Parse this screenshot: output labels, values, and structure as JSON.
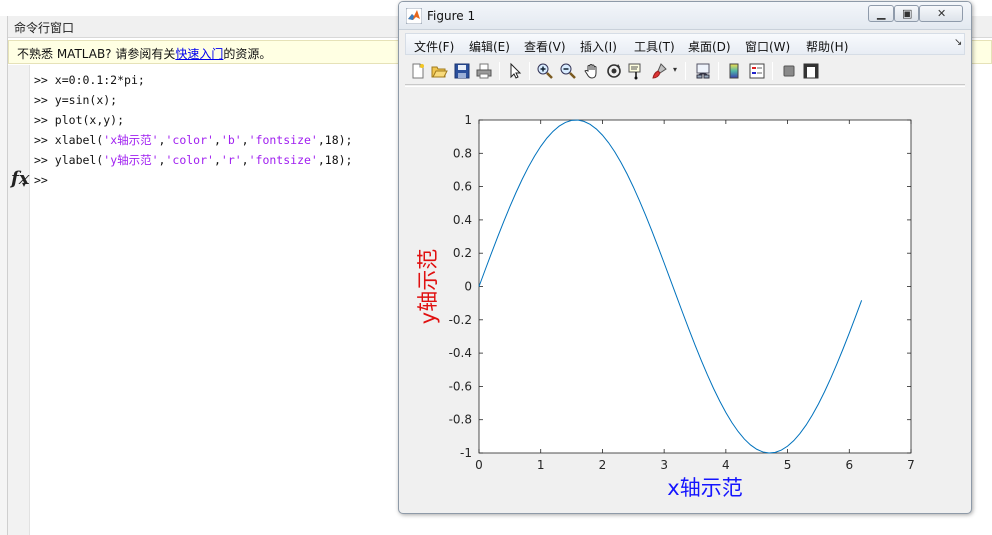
{
  "command_window": {
    "title": "命令行窗口",
    "notice_prefix": "不熟悉 MATLAB? 请参阅有关",
    "notice_link": "快速入门",
    "notice_suffix": "的资源。",
    "prompt": ">>",
    "fx_label": "fx",
    "lines": [
      {
        "code_a": "x=0:0.1:2*pi;",
        "str1": "",
        "code_b": "",
        "str2": "",
        "code_c": "",
        "str3": "",
        "code_d": ""
      },
      {
        "code_a": "y=sin(x);",
        "str1": "",
        "code_b": "",
        "str2": "",
        "code_c": "",
        "str3": "",
        "code_d": ""
      },
      {
        "code_a": "plot(x,y);",
        "str1": "",
        "code_b": "",
        "str2": "",
        "code_c": "",
        "str3": "",
        "code_d": ""
      },
      {
        "code_a": "xlabel(",
        "str1": "'x轴示范'",
        "code_b": ",",
        "str2": "'color'",
        "code_c": ",",
        "str3": "'b'",
        "code_d": ",'fontsize',18);"
      },
      {
        "code_a": "ylabel(",
        "str1": "'y轴示范'",
        "code_b": ",",
        "str2": "'color'",
        "code_c": ",",
        "str3": "'r'",
        "code_d": ",'fontsize',18);"
      },
      {
        "code_a": "",
        "str1": "",
        "code_b": "",
        "str2": "",
        "code_c": "",
        "str3": "",
        "code_d": ""
      }
    ]
  },
  "figure": {
    "title": "Figure 1",
    "menus": [
      "文件(F)",
      "编辑(E)",
      "查看(V)",
      "插入(I)",
      "工具(T)",
      "桌面(D)",
      "窗口(W)",
      "帮助(H)"
    ],
    "toolbar_icons": [
      "new-figure-icon",
      "open-file-icon",
      "save-icon",
      "print-icon",
      "edit-plot-arrow-icon",
      "zoom-in-icon",
      "zoom-out-icon",
      "pan-hand-icon",
      "rotate-3d-icon",
      "data-cursor-icon",
      "brush-icon",
      "brush-dropdown-icon",
      "link-plot-icon",
      "colorbar-icon",
      "legend-icon",
      "hide-plot-tools-icon",
      "show-plot-tools-icon"
    ]
  },
  "chart_data": {
    "type": "line",
    "function": "y = sin(x)",
    "x_start": 0,
    "x_step": 0.1,
    "x_end_label": "2*pi",
    "x": [
      0,
      0.1,
      0.2,
      0.3,
      0.4,
      0.5,
      0.6,
      0.7,
      0.8,
      0.9,
      1.0,
      1.1,
      1.2,
      1.3,
      1.4,
      1.5,
      1.6,
      1.7,
      1.8,
      1.9,
      2.0,
      2.1,
      2.2,
      2.3,
      2.4,
      2.5,
      2.6,
      2.7,
      2.8,
      2.9,
      3.0,
      3.1,
      3.2,
      3.3,
      3.4,
      3.5,
      3.6,
      3.7,
      3.8,
      3.9,
      4.0,
      4.1,
      4.2,
      4.3,
      4.4,
      4.5,
      4.6,
      4.7,
      4.8,
      4.9,
      5.0,
      5.1,
      5.2,
      5.3,
      5.4,
      5.5,
      5.6,
      5.7,
      5.8,
      5.9,
      6.0,
      6.1,
      6.2
    ],
    "y": [
      0,
      0.0998,
      0.1987,
      0.2955,
      0.3894,
      0.4794,
      0.5646,
      0.6442,
      0.7174,
      0.7833,
      0.8415,
      0.8912,
      0.932,
      0.9636,
      0.9854,
      0.9975,
      0.9996,
      0.9917,
      0.9738,
      0.9463,
      0.9093,
      0.8632,
      0.8085,
      0.7457,
      0.6755,
      0.5985,
      0.5155,
      0.4274,
      0.335,
      0.2392,
      0.1411,
      0.0416,
      -0.0584,
      -0.1577,
      -0.2555,
      -0.3508,
      -0.4425,
      -0.5298,
      -0.6119,
      -0.6878,
      -0.7568,
      -0.8183,
      -0.8716,
      -0.9162,
      -0.9516,
      -0.9775,
      -0.9937,
      -0.9999,
      -0.9962,
      -0.9825,
      -0.9589,
      -0.9258,
      -0.8835,
      -0.8323,
      -0.7728,
      -0.7055,
      -0.6313,
      -0.5507,
      -0.4646,
      -0.3739,
      -0.2794,
      -0.1822,
      -0.0831
    ],
    "xlim": [
      0,
      7
    ],
    "ylim": [
      -1,
      1
    ],
    "xticks": [
      "0",
      "1",
      "2",
      "3",
      "4",
      "5",
      "6",
      "7"
    ],
    "yticks": [
      "1",
      "0.8",
      "0.6",
      "0.4",
      "0.2",
      "0",
      "-0.2",
      "-0.4",
      "-0.6",
      "-0.8",
      "-1"
    ],
    "xlabel": "x轴示范",
    "ylabel": "y轴示范",
    "xlabel_color": "#1414ff",
    "ylabel_color": "#e01010",
    "line_color": "#0072bd",
    "grid": false
  }
}
